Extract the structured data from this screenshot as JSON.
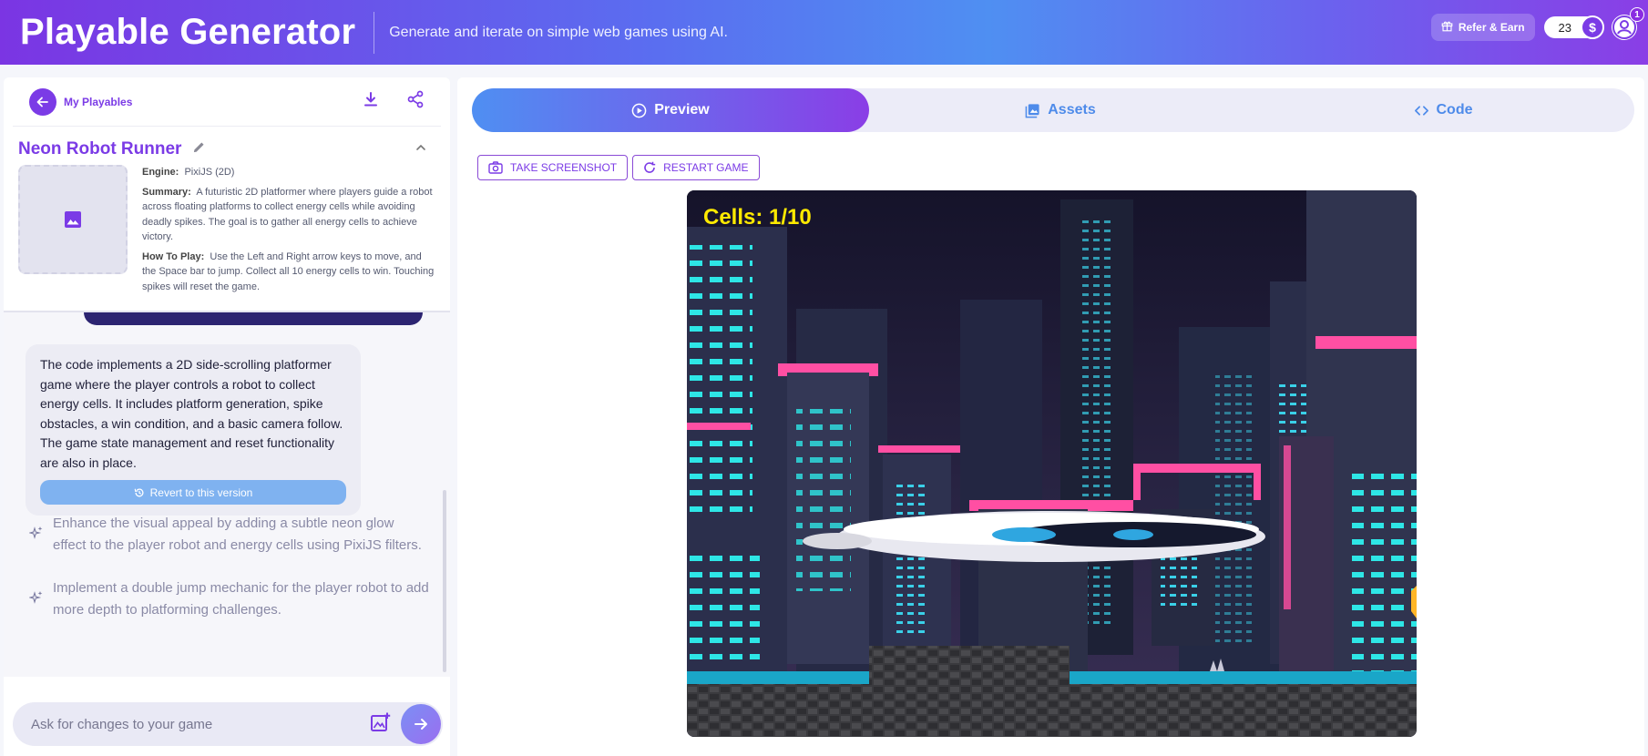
{
  "header": {
    "title": "Playable Generator",
    "subtitle": "Generate and iterate on simple web games using AI.",
    "refer_label": "Refer & Earn",
    "credits": "23",
    "coin_symbol": "$",
    "notifications": "1"
  },
  "sidebar": {
    "back_label": "My Playables",
    "game_title": "Neon Robot Runner",
    "engine_label": "Engine:",
    "engine_value": "PixiJS (2D)",
    "summary_label": "Summary:",
    "summary_value": "A futuristic 2D platformer where players guide a robot across floating platforms to collect energy cells while avoiding deadly spikes. The goal is to gather all energy cells to achieve victory.",
    "howto_label": "How To Play:",
    "howto_value": "Use the Left and Right arrow keys to move, and the Space bar to jump. Collect all 10 energy cells to win. Touching spikes will reset the game."
  },
  "chat": {
    "message": "The code implements a 2D side-scrolling platformer game where the player controls a robot to collect energy cells. It includes platform generation, spike obstacles, a win condition, and a basic camera follow. The game state management and reset functionality are also in place.",
    "revert_label": "Revert to this version",
    "suggestions": [
      "Enhance the visual appeal by adding a subtle neon glow effect to the player robot and energy cells using PixiJS filters.",
      "Implement a double jump mechanic for the player robot to add more depth to platforming challenges."
    ],
    "input_placeholder": "Ask for changes to your game"
  },
  "tabs": {
    "preview": "Preview",
    "assets": "Assets",
    "code": "Code"
  },
  "actions": {
    "screenshot": "Take Screenshot",
    "restart": "Restart Game"
  },
  "game": {
    "hud": "Cells: 1/10"
  },
  "colors": {
    "accent": "#7b3be6",
    "tab_blue": "#4e8bea",
    "hud_yellow": "#ffea00"
  }
}
